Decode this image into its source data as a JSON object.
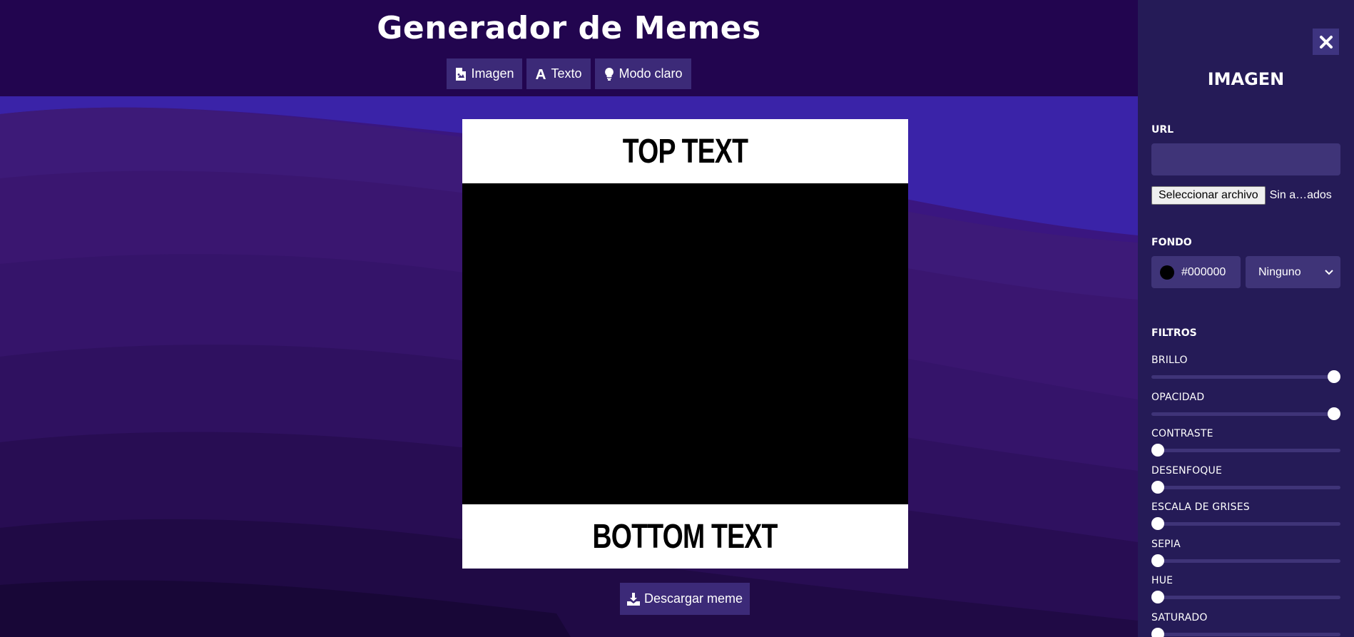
{
  "header": {
    "title": "Generador de Memes",
    "nav": [
      {
        "label": "Imagen",
        "icon": "file-image-icon"
      },
      {
        "label": "Texto",
        "icon": "font-icon"
      },
      {
        "label": "Modo claro",
        "icon": "lightbulb-icon"
      }
    ]
  },
  "meme": {
    "top_text": "TOP TEXT",
    "bottom_text": "BOTTOM TEXT",
    "background_color": "#000000"
  },
  "download": {
    "label": "Descargar meme",
    "icon": "download-icon"
  },
  "panel": {
    "close_icon": "close-icon",
    "title": "IMAGEN",
    "url_label": "URL",
    "url_value": "",
    "file_button": "Seleccionar archivo",
    "file_status": "Sin a…ados",
    "fondo_label": "FONDO",
    "fondo_color": "#000000",
    "fondo_color_text": "#000000",
    "blend_mode": "Ninguno",
    "filtros_label": "FILTROS",
    "filters": [
      {
        "label": "BRILLO",
        "value": 1
      },
      {
        "label": "OPACIDAD",
        "value": 1
      },
      {
        "label": "CONTRASTE",
        "value": 0
      },
      {
        "label": "DESENFOQUE",
        "value": 0
      },
      {
        "label": "ESCALA DE GRISES",
        "value": 0
      },
      {
        "label": "SEPIA",
        "value": 0
      },
      {
        "label": "HUE",
        "value": 0
      },
      {
        "label": "SATURADO",
        "value": 0
      }
    ]
  },
  "colors": {
    "header_bg": "#22054f",
    "button_bg": "#3c2a78",
    "panel_bg": "#251b57",
    "panel_input_bg": "#3f3478"
  }
}
